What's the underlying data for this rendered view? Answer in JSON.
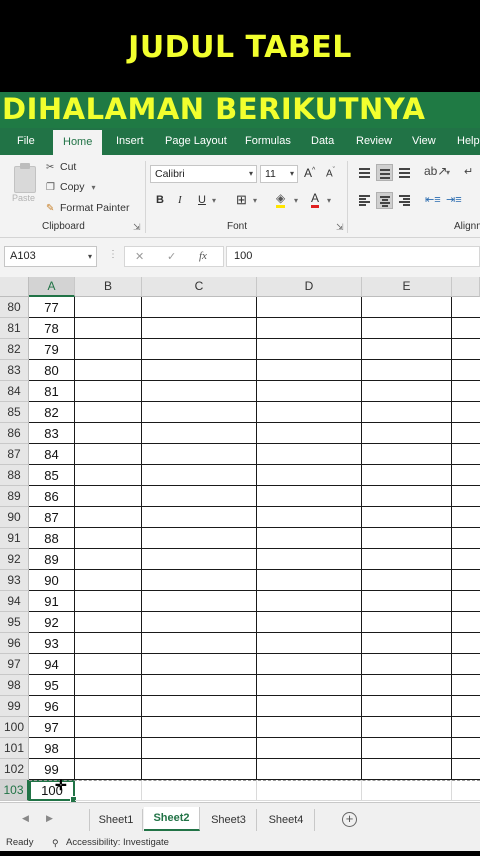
{
  "overlay": {
    "title": "JUDUL TABEL",
    "subtitle": "DIHALAMAN BERIKUTNYA",
    "title_color": "#f2ff2e",
    "band_color": "#1f7a44"
  },
  "ribbon_tabs": [
    "File",
    "Home",
    "Insert",
    "Page Layout",
    "Formulas",
    "Data",
    "Review",
    "View",
    "Help"
  ],
  "active_tab": "Home",
  "clipboard": {
    "paste_label": "Paste",
    "cut_label": "Cut",
    "copy_label": "Copy",
    "format_painter_label": "Format Painter",
    "group_label": "Clipboard"
  },
  "font": {
    "name": "Calibri",
    "size": "11",
    "group_label": "Font",
    "bold": "B",
    "italic": "I",
    "underline": "U"
  },
  "alignment": {
    "group_label": "Alignm"
  },
  "formula_bar": {
    "name_box": "A103",
    "cancel": "✕",
    "enter": "✓",
    "fx": "fx",
    "value": "100"
  },
  "columns": [
    "A",
    "B",
    "C",
    "D",
    "E"
  ],
  "rows": [
    {
      "row": "80",
      "a": "77"
    },
    {
      "row": "81",
      "a": "78"
    },
    {
      "row": "82",
      "a": "79"
    },
    {
      "row": "83",
      "a": "80"
    },
    {
      "row": "84",
      "a": "81"
    },
    {
      "row": "85",
      "a": "82"
    },
    {
      "row": "86",
      "a": "83"
    },
    {
      "row": "87",
      "a": "84"
    },
    {
      "row": "88",
      "a": "85"
    },
    {
      "row": "89",
      "a": "86"
    },
    {
      "row": "90",
      "a": "87"
    },
    {
      "row": "91",
      "a": "88"
    },
    {
      "row": "92",
      "a": "89"
    },
    {
      "row": "93",
      "a": "90"
    },
    {
      "row": "94",
      "a": "91"
    },
    {
      "row": "95",
      "a": "92"
    },
    {
      "row": "96",
      "a": "93"
    },
    {
      "row": "97",
      "a": "94"
    },
    {
      "row": "98",
      "a": "95"
    },
    {
      "row": "99",
      "a": "96"
    },
    {
      "row": "100",
      "a": "97"
    },
    {
      "row": "101",
      "a": "98"
    },
    {
      "row": "102",
      "a": "99"
    },
    {
      "row": "103",
      "a": "100"
    }
  ],
  "sheets": [
    "Sheet1",
    "Sheet2",
    "Sheet3",
    "Sheet4"
  ],
  "active_sheet": "Sheet2",
  "status": {
    "ready": "Ready",
    "accessibility": "Accessibility: Investigate"
  },
  "accent_color": "#217346"
}
